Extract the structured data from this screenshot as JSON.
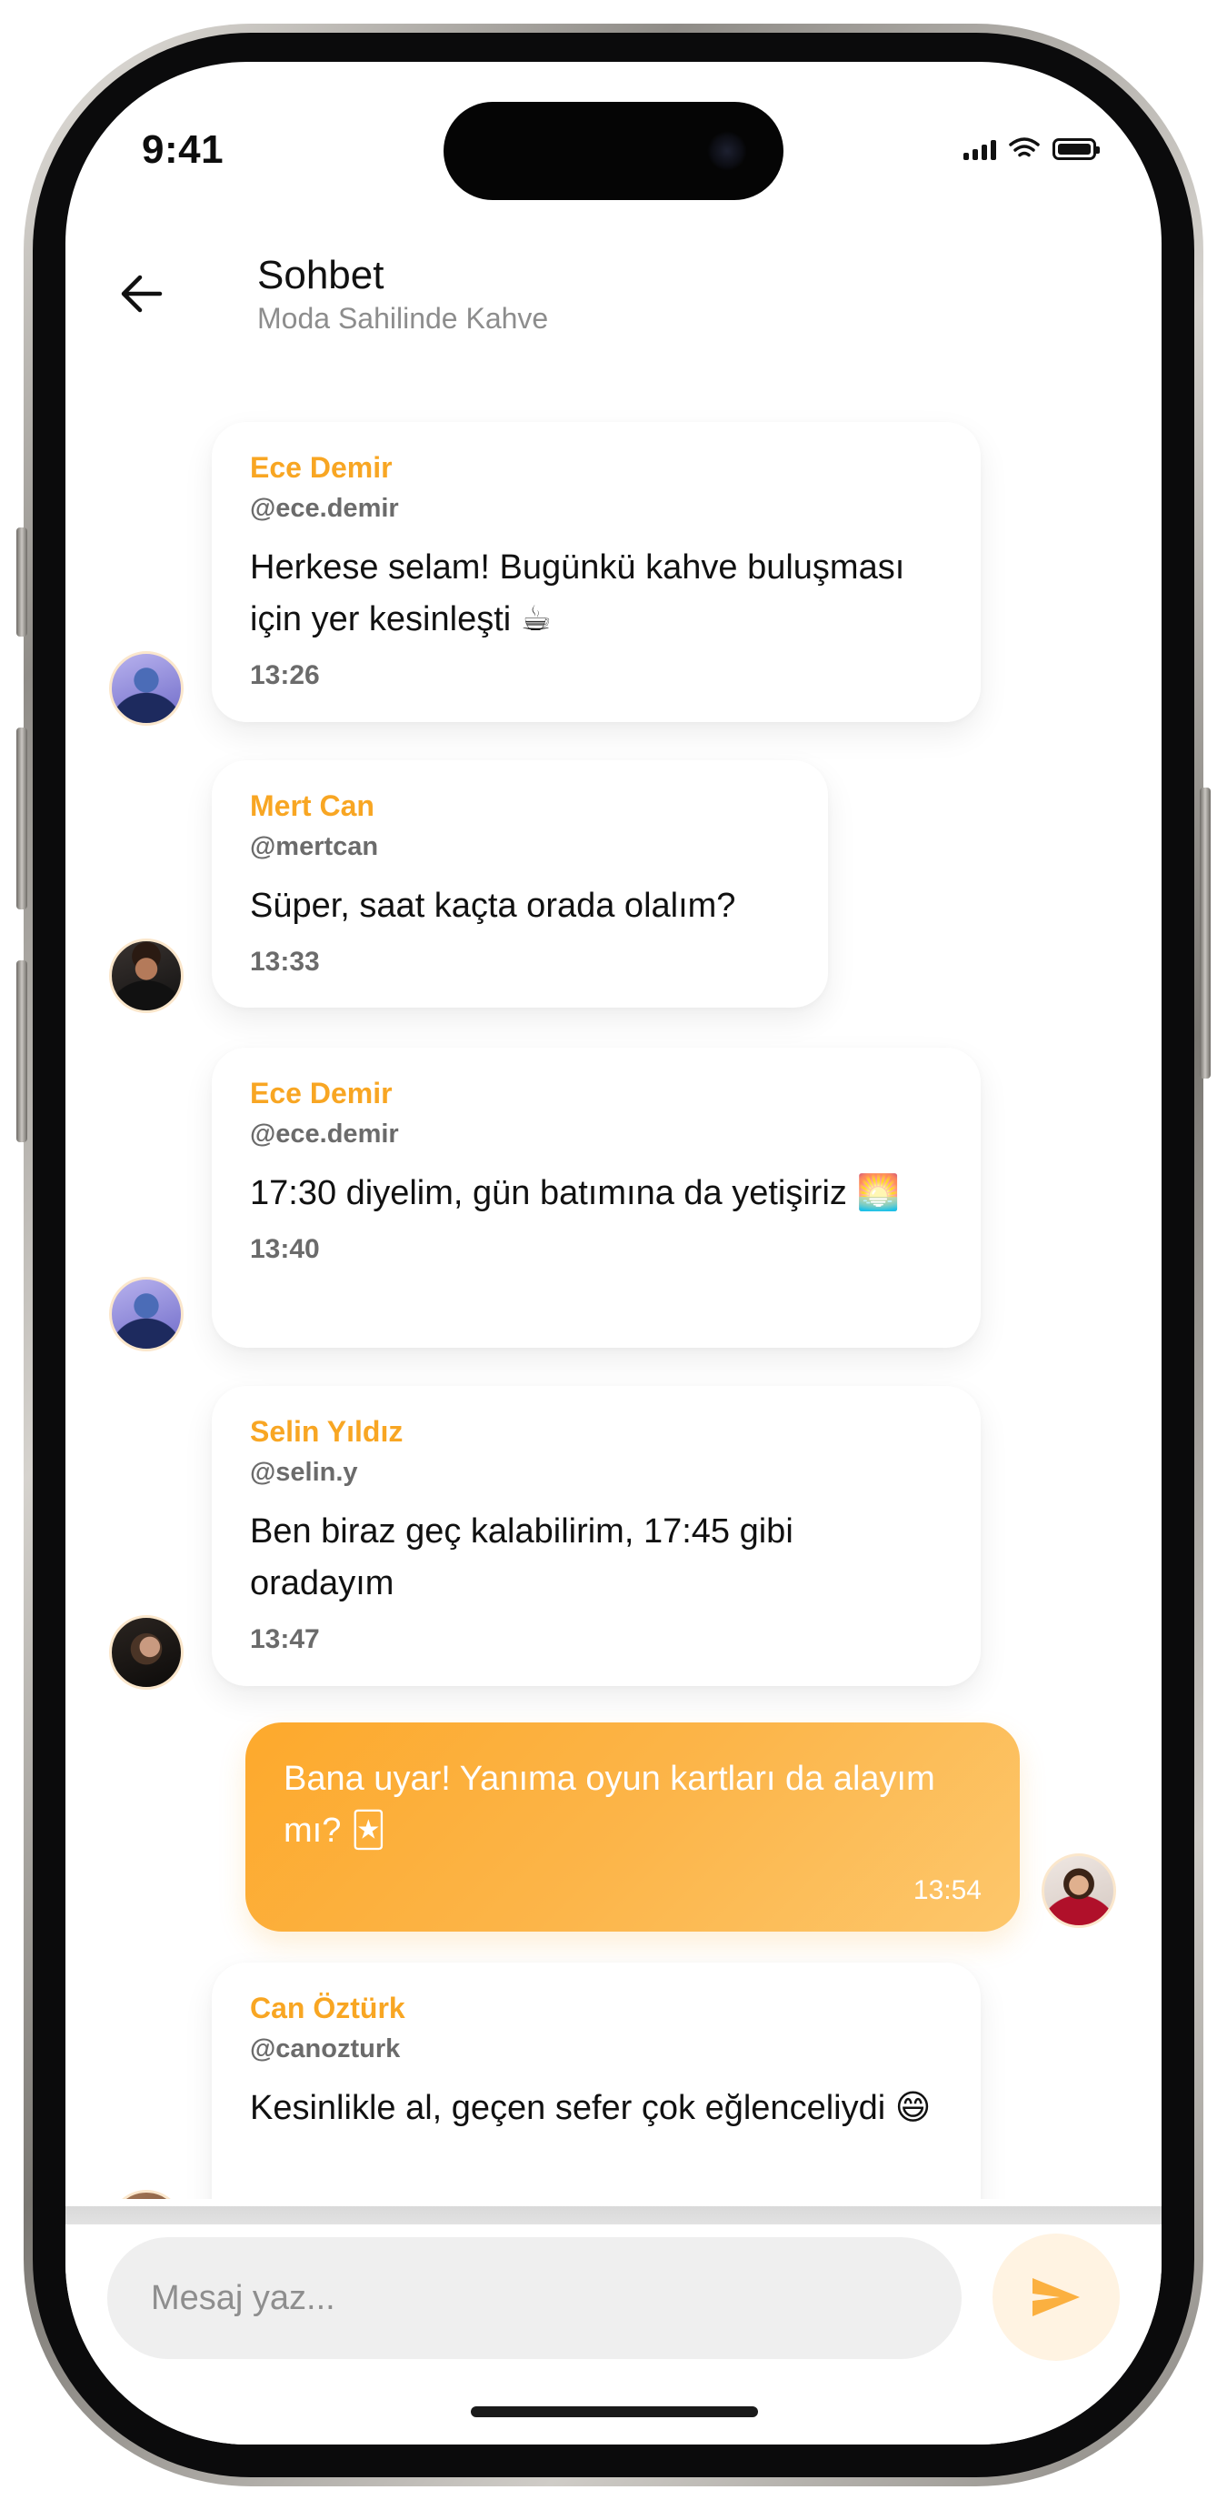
{
  "status": {
    "time": "9:41"
  },
  "header": {
    "title": "Sohbet",
    "subtitle": "Moda Sahilinde Kahve"
  },
  "messages": [
    {
      "name": "Ece Demir",
      "handle": "@ece.demir",
      "text": "Herkese selam! Bugünkü kahve buluşması için yer kesinleşti ☕",
      "time": "13:26",
      "avatar": "ece-demir-avatar"
    },
    {
      "name": "Mert Can",
      "handle": "@mertcan",
      "text": "Süper, saat kaçta orada olalım?",
      "time": "13:33",
      "avatar": "mert-can-avatar"
    },
    {
      "name": "Ece Demir",
      "handle": "@ece.demir",
      "text": "17:30 diyelim, gün batımına da yetişiriz 🌅",
      "time": "13:40",
      "avatar": "ece-demir-avatar"
    },
    {
      "name": "Selin Yıldız",
      "handle": "@selin.y",
      "text": "Ben biraz geç kalabilirim, 17:45 gibi oradayım",
      "time": "13:47",
      "avatar": "selin-yildiz-avatar"
    },
    {
      "mine": true,
      "text": "Bana uyar! Yanıma oyun kartları da alayım mı? 🃏",
      "time": "13:54",
      "avatar": "my-avatar"
    },
    {
      "name": "Can Öztürk",
      "handle": "@canozturk",
      "text": "Kesinlikle al, geçen sefer çok eğlenceliydi 😄",
      "avatar": "can-ozturk-avatar"
    }
  ],
  "composer": {
    "placeholder": "Mesaj yaz..."
  },
  "colors": {
    "accent": "#f8a623",
    "bubble_mine_start": "#fda92c",
    "bubble_mine_end": "#fdc76c",
    "send_button_bg": "#fff3e2"
  },
  "icons": {
    "back": "arrow-left-icon",
    "send": "send-icon"
  }
}
